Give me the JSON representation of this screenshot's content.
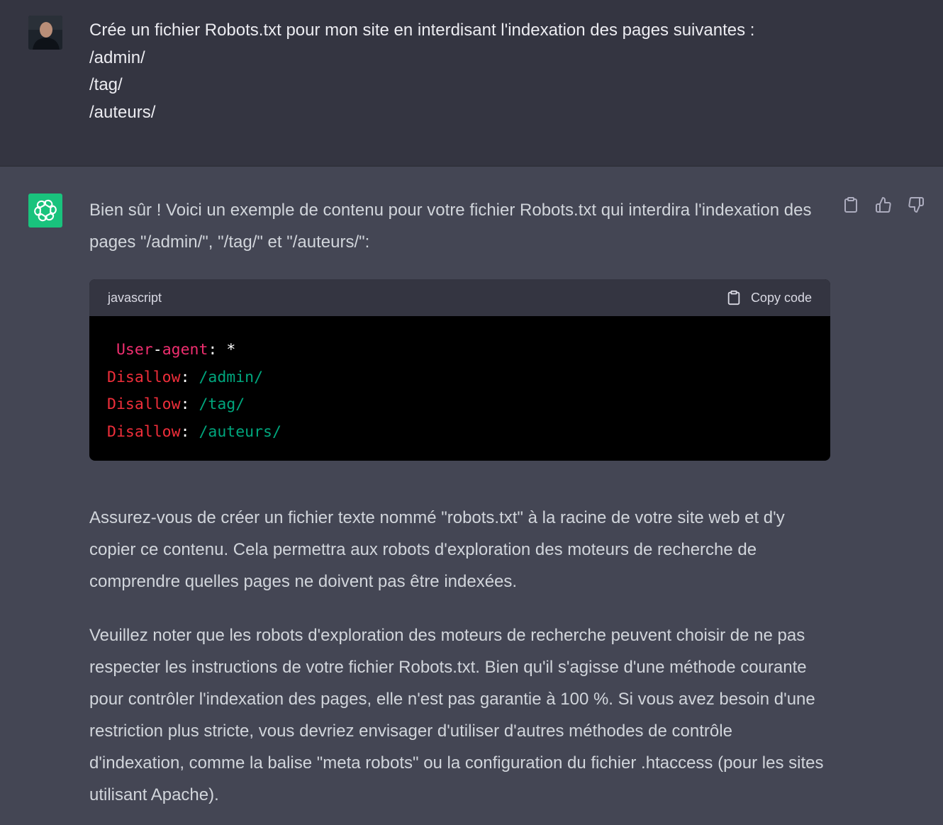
{
  "user": {
    "avatar_icon": "user-photo-avatar",
    "message_lines": [
      "Crée un fichier Robots.txt pour mon site en interdisant l'indexation des pages suivantes :",
      "/admin/",
      "/tag/",
      "/auteurs/"
    ]
  },
  "assistant": {
    "avatar_icon": "openai-logo-icon",
    "avatar_color": "#19c37d",
    "intro": "Bien sûr ! Voici un exemple de contenu pour votre fichier Robots.txt qui interdira l'indexation des pages \"/admin/\", \"/tag/\" et \"/auteurs/\":",
    "code_block": {
      "language": "javascript",
      "copy_label": "Copy code",
      "lines": [
        {
          "key_a": "User",
          "dash": "-",
          "key_b": "agent",
          "sep": ": ",
          "value": "*"
        },
        {
          "key": "Disallow",
          "sep": ": ",
          "value": "/admin/"
        },
        {
          "key": "Disallow",
          "sep": ": ",
          "value": "/tag/"
        },
        {
          "key": "Disallow",
          "sep": ": ",
          "value": "/auteurs/"
        }
      ]
    },
    "paragraph_2": "Assurez-vous de créer un fichier texte nommé \"robots.txt\" à la racine de votre site web et d'y copier ce contenu. Cela permettra aux robots d'exploration des moteurs de recherche de comprendre quelles pages ne doivent pas être indexées.",
    "paragraph_3": "Veuillez noter que les robots d'exploration des moteurs de recherche peuvent choisir de ne pas respecter les instructions de votre fichier Robots.txt. Bien qu'il s'agisse d'une méthode courante pour contrôler l'indexation des pages, elle n'est pas garantie à 100 %. Si vous avez besoin d'une restriction plus stricte, vous devriez envisager d'utiliser d'autres méthodes de contrôle d'indexation, comme la balise \"meta robots\" ou la configuration du fichier .htaccess (pour les sites utilisant Apache).",
    "actions": [
      "clipboard-icon",
      "thumbs-up-icon",
      "thumbs-down-icon"
    ]
  },
  "colors": {
    "user_bg": "#343541",
    "assistant_bg": "#444654",
    "code_key": "#ef2e6f",
    "code_value": "#00a67d"
  }
}
